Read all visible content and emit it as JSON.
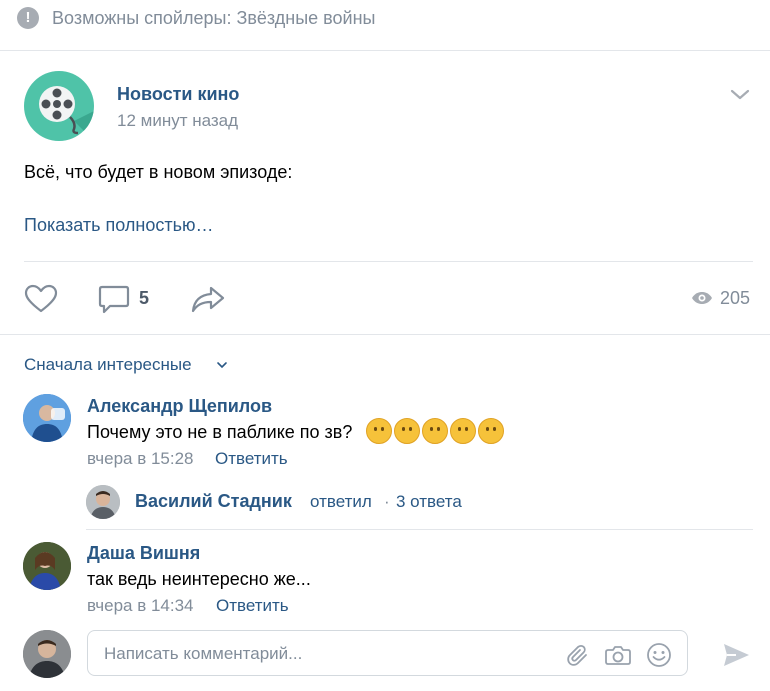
{
  "banner": {
    "icon": "exclamation-icon",
    "icon_glyph": "!",
    "text": "Возможны спойлеры: Звёздные войны"
  },
  "post": {
    "group_name": "Новости кино",
    "time": "12 минут назад",
    "text": "Всё, что будет в новом эпизоде:",
    "show_more": "Показать полностью…",
    "comments_count": "5",
    "views_count": "205"
  },
  "comments": {
    "sort_label": "Сначала интересные",
    "items": [
      {
        "author": "Александр Щепилов",
        "text": "Почему это не в паблике по зв?",
        "emoji_count": 5,
        "time": "вчера в 15:28",
        "reply_label": "Ответить"
      },
      {
        "author": "Даша Вишня",
        "text": "так ведь неинтересно же...",
        "time": "вчера в 14:34",
        "reply_label": "Ответить"
      }
    ],
    "thread": {
      "author": "Василий Стадник",
      "action": "ответил",
      "separator": "·",
      "count_label": "3 ответа"
    }
  },
  "composer": {
    "placeholder": "Написать комментарий...",
    "value": ""
  },
  "colors": {
    "link": "#2a5885",
    "muted": "#818c99",
    "group_avatar": "#4fc3a8",
    "emoji": "#f6c23a"
  }
}
